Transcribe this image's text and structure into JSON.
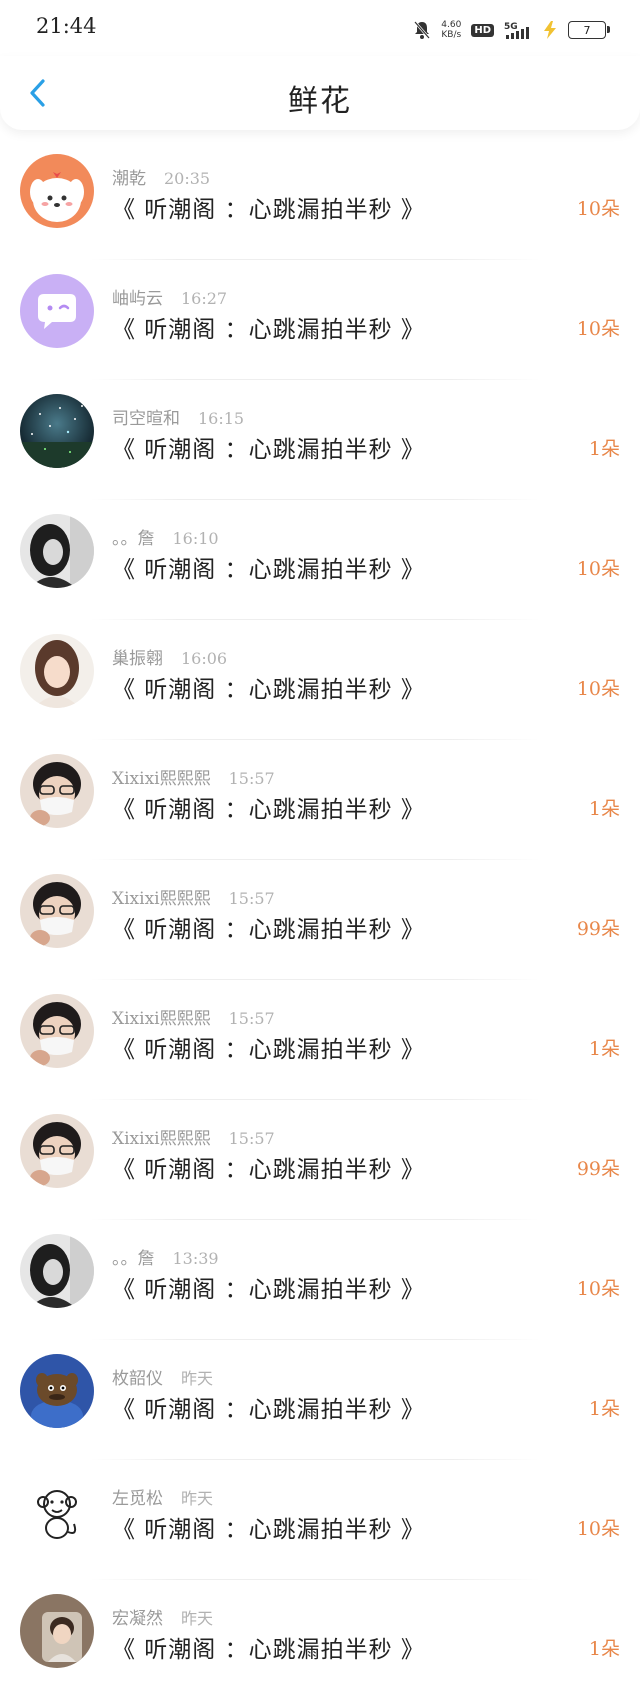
{
  "status_bar": {
    "time": "21:44",
    "net_speed": "4.60",
    "net_unit": "KB/s",
    "hd": "HD",
    "network": "5G",
    "battery": "7"
  },
  "header": {
    "title": "鲜花"
  },
  "colors": {
    "accent_back": "#2aa0e6",
    "count": "#e8874a"
  },
  "items": [
    {
      "name": "潮乾",
      "time": "20:35",
      "book": "《 听潮阁 ：心跳漏拍半秒 》",
      "count": "10朵",
      "avatar": "cartoon-dog-icon"
    },
    {
      "name": "岫屿云",
      "time": "16:27",
      "book": "《 听潮阁 ：心跳漏拍半秒 》",
      "count": "10朵",
      "avatar": "chat-bubble-icon"
    },
    {
      "name": "司空暄和",
      "time": "16:15",
      "book": "《 听潮阁 ：心跳漏拍半秒 》",
      "count": "1朵",
      "avatar": "night-scene-photo"
    },
    {
      "name": "。。詹",
      "time": "16:10",
      "book": "《 听潮阁 ：心跳漏拍半秒 》",
      "count": "10朵",
      "avatar": "bw-girl-photo"
    },
    {
      "name": "巢振翱",
      "time": "16:06",
      "book": "《 听潮阁 ：心跳漏拍半秒 》",
      "count": "10朵",
      "avatar": "girl-photo"
    },
    {
      "name": "Xixixi熙熙熙",
      "time": "15:57",
      "book": "《 听潮阁 ：心跳漏拍半秒 》",
      "count": "1朵",
      "avatar": "masked-boy-photo"
    },
    {
      "name": "Xixixi熙熙熙",
      "time": "15:57",
      "book": "《 听潮阁 ：心跳漏拍半秒 》",
      "count": "99朵",
      "avatar": "masked-boy-photo"
    },
    {
      "name": "Xixixi熙熙熙",
      "time": "15:57",
      "book": "《 听潮阁 ：心跳漏拍半秒 》",
      "count": "1朵",
      "avatar": "masked-boy-photo"
    },
    {
      "name": "Xixixi熙熙熙",
      "time": "15:57",
      "book": "《 听潮阁 ：心跳漏拍半秒 》",
      "count": "99朵",
      "avatar": "masked-boy-photo"
    },
    {
      "name": "。。詹",
      "time": "13:39",
      "book": "《 听潮阁 ：心跳漏拍半秒 》",
      "count": "10朵",
      "avatar": "bw-girl-photo"
    },
    {
      "name": "枚韶仪",
      "time": "昨天",
      "book": "《 听潮阁 ：心跳漏拍半秒 》",
      "count": "1朵",
      "avatar": "cartoon-character-photo"
    },
    {
      "name": "左觅松",
      "time": "昨天",
      "book": "《 听潮阁 ：心跳漏拍半秒 》",
      "count": "10朵",
      "avatar": "monkey-sketch-icon"
    },
    {
      "name": "宏凝然",
      "time": "昨天",
      "book": "《 听潮阁 ：心跳漏拍半秒 》",
      "count": "1朵",
      "avatar": "boy-photo"
    }
  ]
}
